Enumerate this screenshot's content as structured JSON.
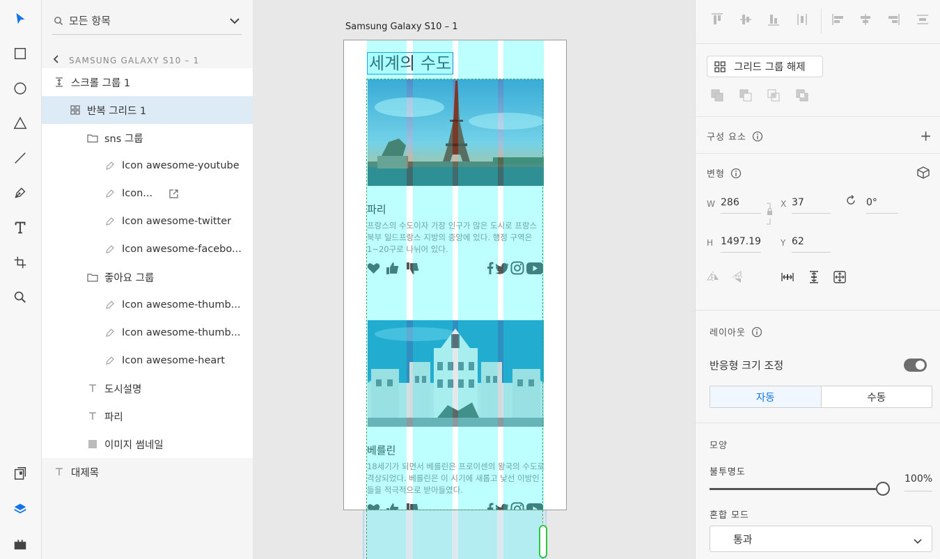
{
  "search": {
    "placeholder": "모든 항목"
  },
  "breadcrumb": {
    "label": "SAMSUNG GALAXY S10 – 1"
  },
  "layers": [
    {
      "label": "스크롤 그룹 1",
      "icon": "scroll-group-icon"
    },
    {
      "label": "반복 그리드 1",
      "icon": "repeat-grid-icon",
      "selected": true
    },
    {
      "label": "sns 그룹",
      "icon": "folder-icon"
    },
    {
      "label": "Icon awesome-youtube",
      "icon": "pen-path-icon"
    },
    {
      "label": "Icon...",
      "icon": "pen-path-icon"
    },
    {
      "label": "Icon awesome-twitter",
      "icon": "pen-path-icon"
    },
    {
      "label": "Icon awesome-facebo...",
      "icon": "pen-path-icon"
    },
    {
      "label": "좋아요 그룹",
      "icon": "folder-icon"
    },
    {
      "label": "Icon awesome-thumb...",
      "icon": "pen-path-icon"
    },
    {
      "label": "Icon awesome-thumb...",
      "icon": "pen-path-icon"
    },
    {
      "label": "Icon awesome-heart",
      "icon": "pen-path-icon"
    },
    {
      "label": "도시설명",
      "icon": "text-icon"
    },
    {
      "label": "파리",
      "icon": "text-icon"
    },
    {
      "label": "이미지 썸네일",
      "icon": "rectangle-icon"
    },
    {
      "label": "대제목",
      "icon": "text-icon"
    }
  ],
  "artboard": {
    "title": "Samsung Galaxy S10 – 1",
    "heading": "세계의 수도",
    "cards": [
      {
        "city": "파리",
        "description": "프랑스의 수도이자 가장 인구가 많은 도시로 프랑스 북부 일드프랑스 지방의 중앙에 있다. 행정 구역은 1~20구로 나뉘어 있다."
      },
      {
        "city": "베를린",
        "description": "18세기가 되면서 베를린은 프로이센의 왕국의 수도로 격상되었다. 베를린은 이 시기에 새롭고 낯선 이방인들을 적극적으로 받아들였다."
      }
    ]
  },
  "inspector": {
    "ungroup_label": "그리드 그룹 해제",
    "components_label": "구성 요소",
    "transform_label": "변형",
    "w_label": "W",
    "w_value": "286",
    "h_label": "H",
    "h_value": "1497.19",
    "x_label": "X",
    "x_value": "37",
    "y_label": "Y",
    "y_value": "62",
    "rotation_value": "0°",
    "layout_label": "레이아웃",
    "responsive_label": "반응형 크기 조정",
    "responsive_on": true,
    "auto_label": "자동",
    "manual_label": "수동",
    "appearance_label": "모양",
    "opacity_label": "불투명도",
    "opacity_value": "100%",
    "opacity_level": 1.0,
    "blend_label": "혼합 모드",
    "blend_value": "통과"
  },
  "colors": {
    "accent": "#1473e6",
    "selection": "#ddebf7",
    "grid_column": "#00ffff",
    "scroll_handle": "#28c840"
  }
}
